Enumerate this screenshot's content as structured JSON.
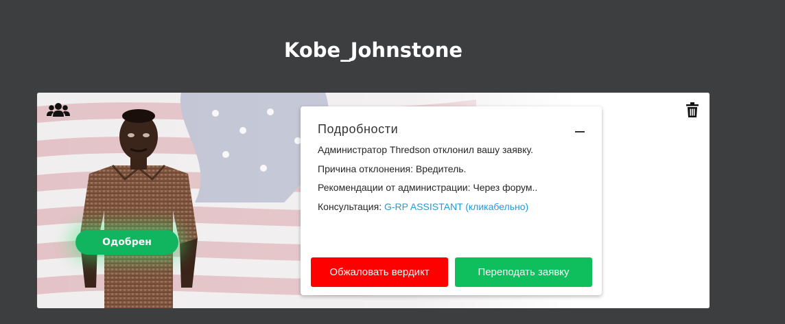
{
  "page": {
    "title": "Kobe_Johnstone"
  },
  "card": {
    "status_badge": "Одобрен",
    "icons": {
      "group": "group-icon",
      "delete": "trash-icon"
    },
    "colors": {
      "status_green": "#11b55f",
      "appeal_red": "#ff0000",
      "resubmit_green": "#0fbe5d",
      "link_blue": "#1e9be0"
    }
  },
  "details": {
    "title": "Подробности",
    "lines": [
      "Администратор Thredson отклонил вашу заявку.",
      "Причина отклонения: Вредитель.",
      "Рекомендации от администрации: Через форум.."
    ],
    "consult_label": "Консультация: ",
    "consult_link": "G-RP ASSISTANT (кликабельно)",
    "buttons": {
      "appeal": "Обжаловать вердикт",
      "resubmit": "Переподать заявку"
    }
  }
}
